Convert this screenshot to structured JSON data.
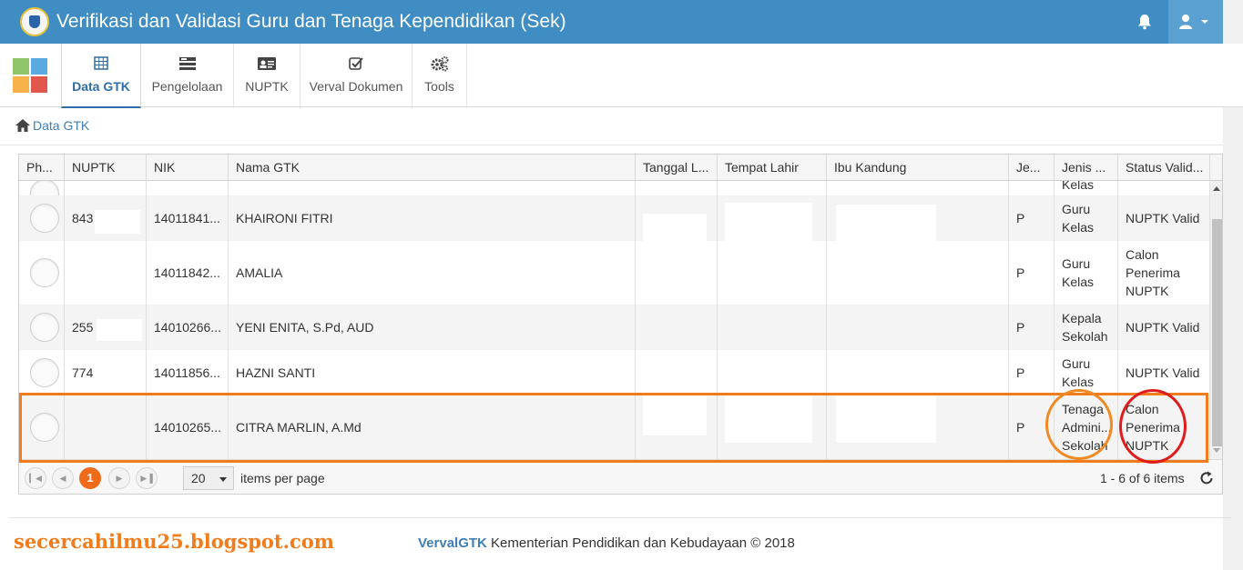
{
  "header": {
    "title": "Verifikasi dan Validasi Guru dan Tenaga Kependidikan (Sek)",
    "colors": {
      "bar": "#3f8dc3",
      "accent": "#ef6a1a"
    }
  },
  "tabs": [
    {
      "label": "Data GTK",
      "icon": "table-icon",
      "active": true
    },
    {
      "label": "Pengelolaan",
      "icon": "list-icon"
    },
    {
      "label": "NUPTK",
      "icon": "id-card-icon"
    },
    {
      "label": "Verval Dokumen",
      "icon": "checkbox-icon"
    },
    {
      "label": "Tools",
      "icon": "gears-icon"
    }
  ],
  "breadcrumb": {
    "label": "Data GTK"
  },
  "grid": {
    "columns": [
      "Ph...",
      "NUPTK",
      "NIK",
      "Nama GTK",
      "Tanggal L...",
      "Tempat Lahir",
      "Ibu Kandung",
      "Je...",
      "Jenis ...",
      "Status Valid..."
    ],
    "partial_top": {
      "jenis": "Kelas"
    },
    "rows": [
      {
        "nuptk": "843",
        "nik": "14011841...",
        "nama": "KHAIRONI FITRI",
        "je": "P",
        "jenis": "Guru Kelas",
        "status": "NUPTK Valid"
      },
      {
        "nuptk": "",
        "nik": "14011842...",
        "nama": "AMALIA",
        "je": "P",
        "jenis": "Guru Kelas",
        "status": "Calon Penerima NUPTK"
      },
      {
        "nuptk": "255",
        "nik": "14010266...",
        "nama": "YENI ENITA, S.Pd, AUD",
        "je": "P",
        "jenis": "Kepala Sekolah",
        "status": "NUPTK Valid"
      },
      {
        "nuptk": "774",
        "nik": "14011856...",
        "nama": "HAZNI SANTI",
        "je": "P",
        "jenis": "Guru Kelas",
        "status": "NUPTK Valid"
      },
      {
        "nuptk": "",
        "nik": "14010265...",
        "nama": "CITRA MARLIN, A.Md",
        "je": "P",
        "jenis": "Tenaga Admini... Sekolah",
        "status": "Calon Penerima NUPTK"
      }
    ]
  },
  "pager": {
    "current_page": "1",
    "page_size": "20",
    "items_per_page_label": "items per page",
    "info": "1 - 6 of 6 items"
  },
  "footer": {
    "watermark": "secercahilmu25.blogspot.com",
    "brand": "VervalGTK",
    "text": "Kementerian Pendidikan dan Kebudayaan © 2018"
  }
}
